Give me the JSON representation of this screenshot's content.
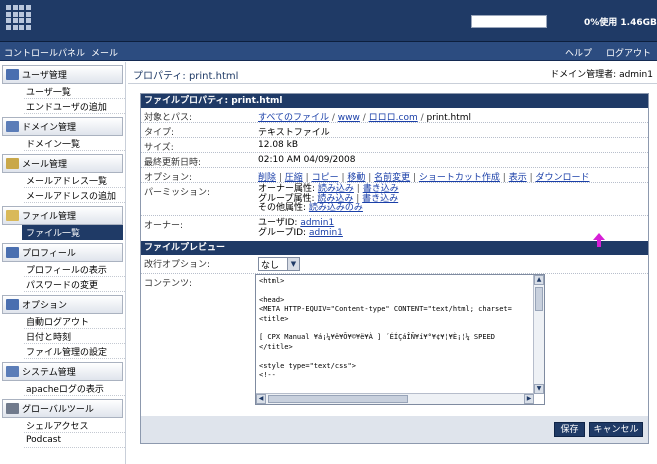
{
  "topbar": {
    "usage_text": "0%使用 1.46GB",
    "usage_fraction": 0.0
  },
  "menu": {
    "control_panel": "コントロールパネル",
    "mail": "メール",
    "help": "ヘルプ",
    "logout": "ログアウト"
  },
  "sidebar": {
    "sections": [
      {
        "title": "ユーザ管理",
        "icon": "user-icon",
        "items": [
          "ユーザ一覧",
          "エンドユーザの追加"
        ]
      },
      {
        "title": "ドメイン管理",
        "icon": "domain-icon",
        "items": [
          "ドメイン一覧"
        ]
      },
      {
        "title": "メール管理",
        "icon": "mail-icon",
        "items": [
          "メールアドレス一覧",
          "メールアドレスの追加"
        ]
      },
      {
        "title": "ファイル管理",
        "icon": "folder-icon",
        "items": [
          "ファイル一覧"
        ]
      },
      {
        "title": "プロフィール",
        "icon": "profile-icon",
        "items": [
          "プロフィールの表示",
          "パスワードの変更"
        ]
      },
      {
        "title": "オプション",
        "icon": "options-icon",
        "items": [
          "自動ログアウト",
          "日付と時刻",
          "ファイル管理の設定"
        ]
      },
      {
        "title": "システム管理",
        "icon": "system-icon",
        "items": [
          "apacheログの表示"
        ]
      },
      {
        "title": "グローバルツール",
        "icon": "tools-icon",
        "items": [
          "シェルアクセス",
          "Podcast"
        ]
      }
    ],
    "selected": "ファイル一覧"
  },
  "page": {
    "title": "プロパティ: print.html",
    "admin_label": "ドメイン管理者: admin1"
  },
  "properties": {
    "header": "ファイルプロパティ: print.html",
    "path_label": "対象とパス:",
    "path_links": [
      "すべてのファイル",
      "www",
      "ロロロ.com"
    ],
    "path_file": "print.html",
    "type_label": "タイプ:",
    "type_value": "テキストファイル",
    "size_label": "サイズ:",
    "size_value": "12.08 kB",
    "modified_label": "最終更新日時:",
    "modified_value": "02:10 AM 04/09/2008",
    "options_label": "オプション:",
    "options": [
      "削除",
      "圧縮",
      "コピー",
      "移動",
      "名前変更",
      "ショートカット作成",
      "表示",
      "ダウンロード"
    ],
    "perm_label": "パーミッション:",
    "perm_owner": "オーナー属性:",
    "perm_group": "グループ属性:",
    "perm_other": "その他属性:",
    "read_write": "読み込み",
    "write": "書き込み",
    "read_only": "読み込みのみ",
    "owner_label": "オーナー:",
    "user_id_label": "ユーザID:",
    "user_id": "admin1",
    "group_id_label": "グループID:",
    "group_id": "admin1"
  },
  "preview": {
    "header": "ファイルプレビュー",
    "newline_label": "改行オプション:",
    "newline_value": "なし",
    "content_label": "コンテンツ:",
    "code_lines": [
      "<html>",
      "",
      "<head>",
      "<META HTTP-EQUIV=\"Content-type\" CONTENT=\"text/html; charset=",
      "<title>",
      "",
      "[ CPX Manual ¥á¡¼¥ë¥Õ¥©¥ë¥À ] ´ÉÍ­ÇáÎÑ¥í¥°¥¢¥¦¥È¡¦¼ SPEED",
      "</title>",
      "",
      "<style type=\"text/css\">",
      "<!--"
    ]
  },
  "buttons": {
    "save": "保存",
    "cancel": "キャンセル"
  },
  "colors": {
    "header_bg": "#1f3a66",
    "link": "#1a3fa8",
    "pointer": "#d61fd6"
  }
}
